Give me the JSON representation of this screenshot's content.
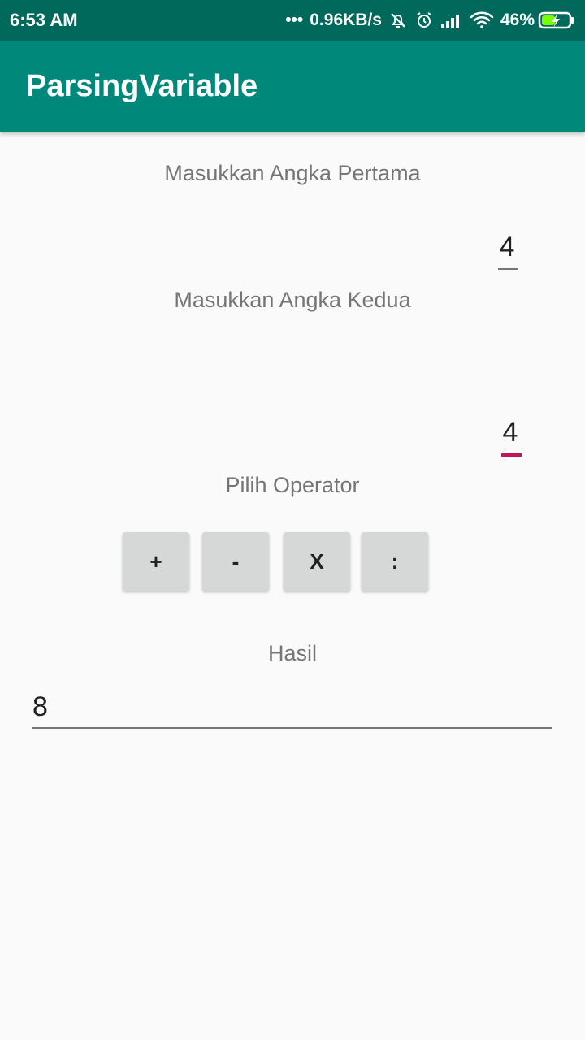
{
  "status_bar": {
    "time": "6:53 AM",
    "dots": "•••",
    "network_speed": "0.96KB/s",
    "battery_percent": "46%",
    "icons": [
      "silent-bell-icon",
      "alarm-icon",
      "signal-icon",
      "wifi-icon",
      "battery-charging-icon"
    ]
  },
  "app_bar": {
    "title": "ParsingVariable"
  },
  "form": {
    "first_label": "Masukkan Angka Pertama",
    "first_value": "4",
    "second_label": "Masukkan Angka Kedua",
    "second_value": "4",
    "operator_label": "Pilih Operator",
    "operators": [
      "+",
      "-",
      "X",
      ":"
    ],
    "result_label": "Hasil",
    "result_value": "8"
  },
  "colors": {
    "status_bar": "#00695c",
    "app_bar": "#00897b",
    "accent": "#c2185b",
    "background": "#fafafa",
    "button": "#d6d7d7"
  }
}
